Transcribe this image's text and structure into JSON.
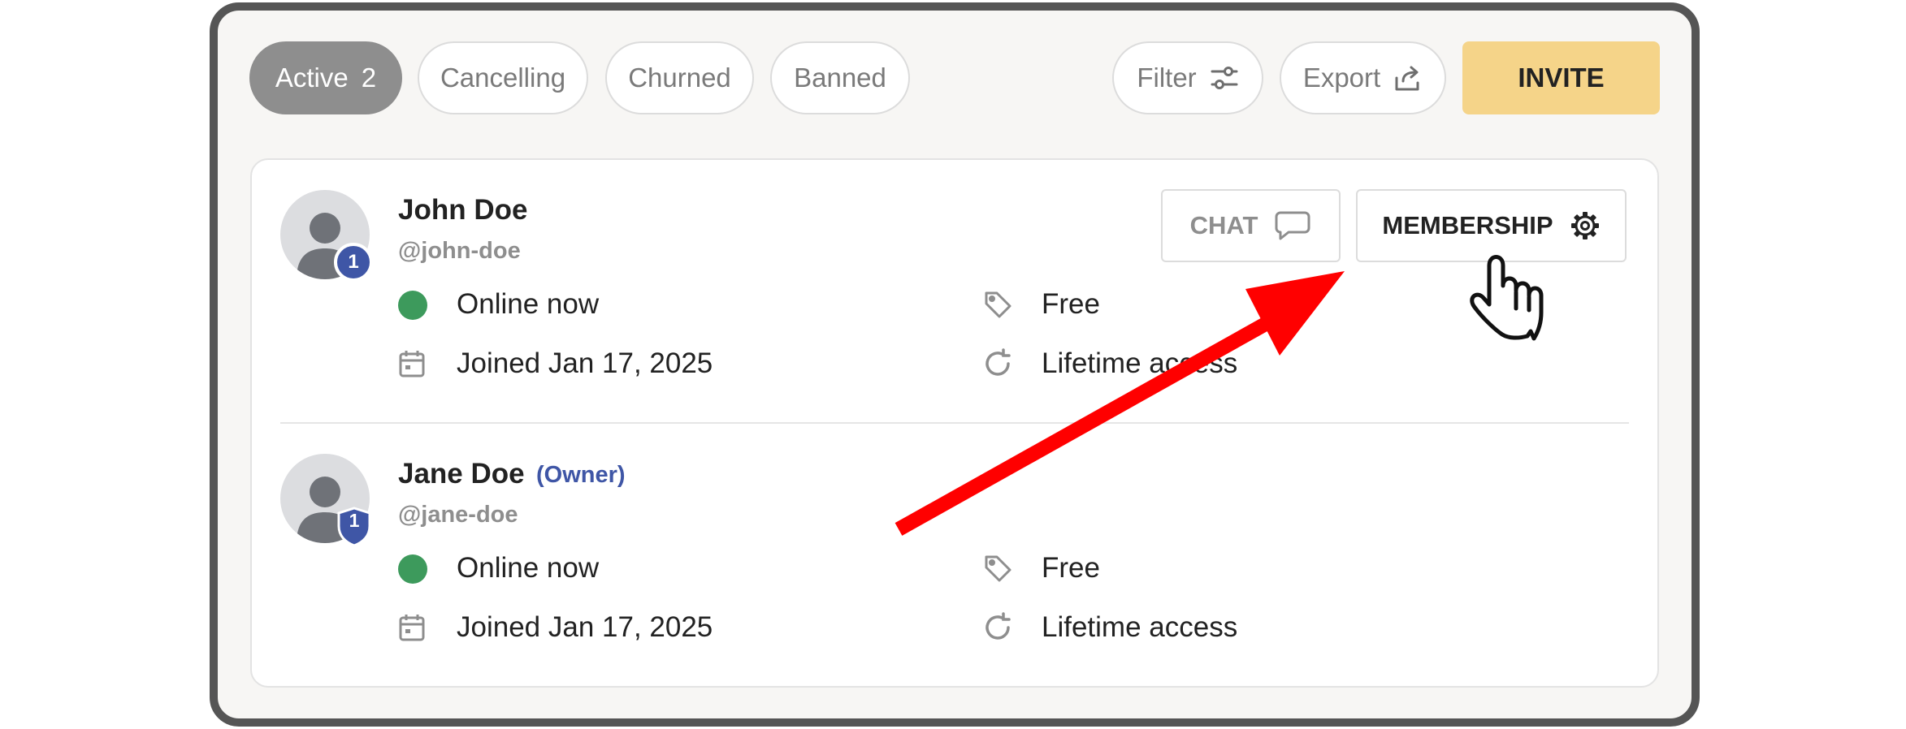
{
  "filters": {
    "tabs": [
      {
        "label": "Active",
        "count": "2"
      },
      {
        "label": "Cancelling"
      },
      {
        "label": "Churned"
      },
      {
        "label": "Banned"
      }
    ],
    "filter_label": "Filter",
    "export_label": "Export",
    "invite_label": "INVITE"
  },
  "members": [
    {
      "name": "John Doe",
      "handle": "@john-doe",
      "level": "1",
      "status": "Online now",
      "joined": "Joined Jan 17, 2025",
      "plan": "Free",
      "access": "Lifetime access",
      "actions": {
        "chat_label": "CHAT",
        "membership_label": "MEMBERSHIP"
      }
    },
    {
      "name": "Jane Doe",
      "role": "(Owner)",
      "handle": "@jane-doe",
      "level": "1",
      "status": "Online now",
      "joined": "Joined Jan 17, 2025",
      "plan": "Free",
      "access": "Lifetime access"
    }
  ],
  "colors": {
    "online": "#3d9a5c",
    "badge": "#3f56a6",
    "invite": "#f5d489",
    "active_tab": "#8e8e8e",
    "annotation_arrow": "#ff0000"
  },
  "icons": [
    "filter-sliders-icon",
    "export-icon",
    "chat-bubble-icon",
    "gear-icon",
    "tag-icon",
    "calendar-icon",
    "refresh-icon",
    "hand-pointer-icon"
  ]
}
